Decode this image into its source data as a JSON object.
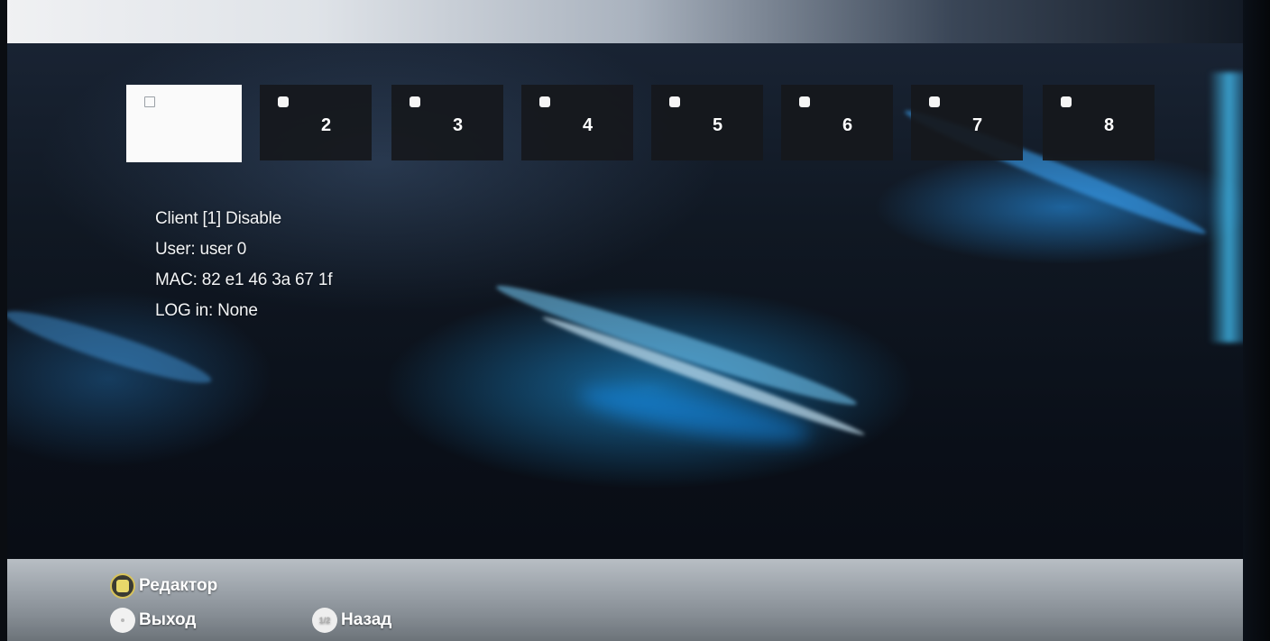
{
  "clients": {
    "tiles": [
      {
        "label": "",
        "selected": true
      },
      {
        "label": "2",
        "selected": false
      },
      {
        "label": "3",
        "selected": false
      },
      {
        "label": "4",
        "selected": false
      },
      {
        "label": "5",
        "selected": false
      },
      {
        "label": "6",
        "selected": false
      },
      {
        "label": "7",
        "selected": false
      },
      {
        "label": "8",
        "selected": false
      }
    ]
  },
  "info": {
    "client_status": "Client [1] Disable",
    "user": "User: user 0",
    "mac": "MAC: 82 e1 46 3a 67 1f",
    "login": "LOG in: None"
  },
  "footer": {
    "editor_label": "Редактор",
    "exit_label": "Выход",
    "back_label": "Назад",
    "back_icon_text": "1/2"
  },
  "colors": {
    "accent_yellow": "#e8d86a",
    "tile_bg": "#16181c",
    "tile_active_bg": "#fafafa",
    "footer_bg": "#9ea5ac"
  }
}
